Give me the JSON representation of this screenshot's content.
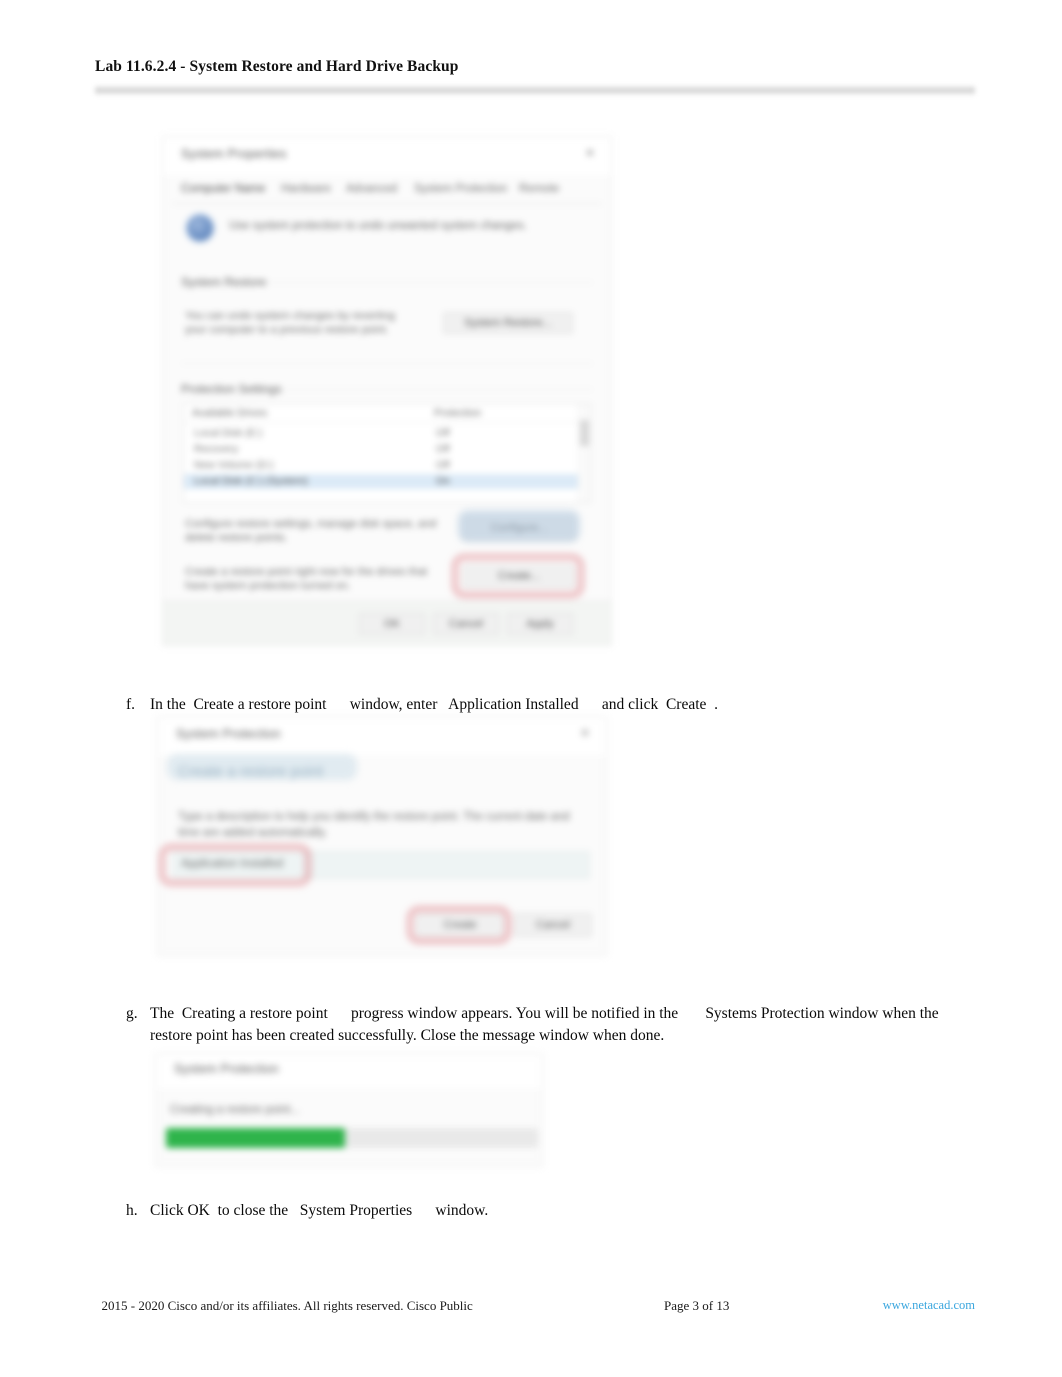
{
  "header": {
    "title": "Lab 11.6.2.4 - System Restore and Hard Drive Backup"
  },
  "steps": [
    {
      "marker": "f.",
      "text": "In the  Create a restore point      window, enter   Application Installed      and click  Create  ."
    },
    {
      "marker": "g.",
      "text": "The  Creating a restore point      progress window appears. You will be notified in the       Systems Protection window when the restore point has been created successfully. Close the message window when done."
    },
    {
      "marker": "h.",
      "text": "Click OK  to close the   System Properties      window."
    }
  ],
  "screenshot_system_properties": {
    "window_title": "System Properties",
    "close_label": "✕",
    "tabs": [
      {
        "label": "Computer Name",
        "active": false
      },
      {
        "label": "Hardware",
        "active": false
      },
      {
        "label": "Advanced",
        "active": false
      },
      {
        "label": "System Protection",
        "active": true
      },
      {
        "label": "Remote",
        "active": false
      }
    ],
    "info_text": "Use system protection to undo unwanted system changes.",
    "groups": {
      "system_restore_label": "System Restore",
      "system_restore_desc": "You can undo system changes by reverting your computer to a previous restore point.",
      "system_restore_button": "System Restore...",
      "protection_settings_label": "Protection Settings"
    },
    "list": {
      "columns": [
        "Available Drives",
        "Protection"
      ],
      "rows": [
        {
          "drive": "Local Disk (E:)",
          "protection": "Off",
          "selected": false
        },
        {
          "drive": "Recovery",
          "protection": "Off",
          "selected": false
        },
        {
          "drive": "New Volume (D:)",
          "protection": "Off",
          "selected": false
        },
        {
          "drive": "Local Disk (C:) (System)",
          "protection": "On",
          "selected": true
        }
      ]
    },
    "configure": {
      "desc": "Configure restore settings, manage disk space, and delete restore points.",
      "button": "Configure..."
    },
    "create": {
      "desc": "Create a restore point right now for the drives that have system protection turned on.",
      "button": "Create..."
    },
    "footer_buttons": [
      "OK",
      "Cancel",
      "Apply"
    ]
  },
  "screenshot_create_restore_point": {
    "window_title": "System Protection",
    "close_label": "✕",
    "heading": "Create a restore point",
    "subtext": "Type a description to help you identify the restore point. The current date and time are added automatically.",
    "input_value": "Application Installed",
    "buttons": [
      "Create",
      "Cancel"
    ]
  },
  "screenshot_progress": {
    "window_title": "System Protection",
    "status_label": "Creating a restore point...",
    "progress_percent": 48
  },
  "footer": {
    "copyright": "  2015 - 2020 Cisco and/or its affiliates. All rights reserved. Cisco Public",
    "page": "Page   3 of 13",
    "link": "www.netacad.com"
  },
  "colors": {
    "link": "#3aa6de",
    "progress_fill": "#2fb44b",
    "highlight_red": "#d66068",
    "highlight_blue": "#82a8c8",
    "selected_row": "#dbeaf7"
  }
}
